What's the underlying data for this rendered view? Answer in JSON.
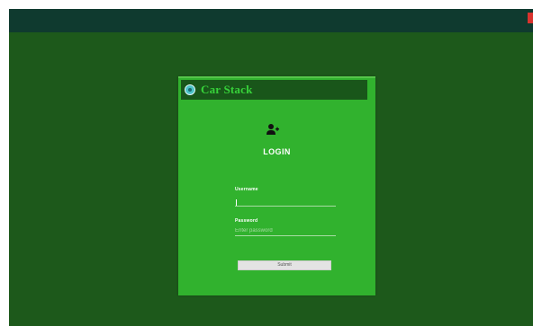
{
  "app": {
    "brand": "Car Stack"
  },
  "login": {
    "title": "LOGIN",
    "username_label": "Username",
    "username_value": "",
    "password_label": "Password",
    "password_placeholder": "Enter password",
    "submit_label": "Submit"
  },
  "icons": {
    "logo": "brand-logo-icon",
    "user": "user-icon",
    "close": "close-icon"
  },
  "colors": {
    "background": "#1d591b",
    "titlebar": "#0f3a2f",
    "card": "#31b22e",
    "card_header": "#19561a",
    "brand_text": "#37d23a",
    "close": "#d9332e"
  }
}
